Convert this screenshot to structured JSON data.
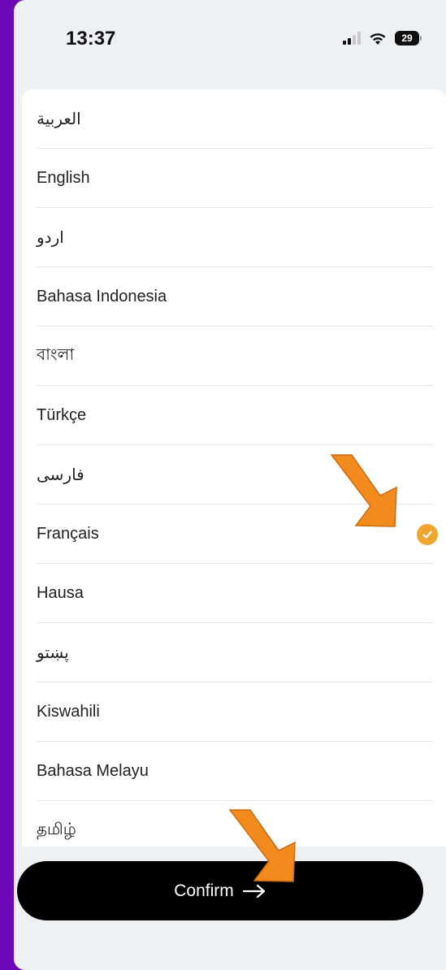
{
  "status_bar": {
    "time": "13:37",
    "battery": "29"
  },
  "languages": [
    {
      "label": "العربية",
      "rtl": true,
      "selected": false
    },
    {
      "label": "English",
      "rtl": false,
      "selected": false
    },
    {
      "label": "اردو",
      "rtl": true,
      "selected": false
    },
    {
      "label": "Bahasa Indonesia",
      "rtl": false,
      "selected": false
    },
    {
      "label": "বাংলা",
      "rtl": false,
      "selected": false
    },
    {
      "label": "Türkçe",
      "rtl": false,
      "selected": false
    },
    {
      "label": "فارسی",
      "rtl": true,
      "selected": false
    },
    {
      "label": "Français",
      "rtl": false,
      "selected": true
    },
    {
      "label": "Hausa",
      "rtl": false,
      "selected": false
    },
    {
      "label": "پښتو",
      "rtl": true,
      "selected": false
    },
    {
      "label": "Kiswahili",
      "rtl": false,
      "selected": false
    },
    {
      "label": "Bahasa Melayu",
      "rtl": false,
      "selected": false
    },
    {
      "label": "தமிழ்",
      "rtl": false,
      "selected": false
    }
  ],
  "confirm_button": {
    "label": "Confirm",
    "icon": "arrow-right-icon"
  },
  "colors": {
    "accent_check": "#f0a530",
    "annotation_arrow": "#f28a1e",
    "background_purple": "#7a10cf"
  }
}
